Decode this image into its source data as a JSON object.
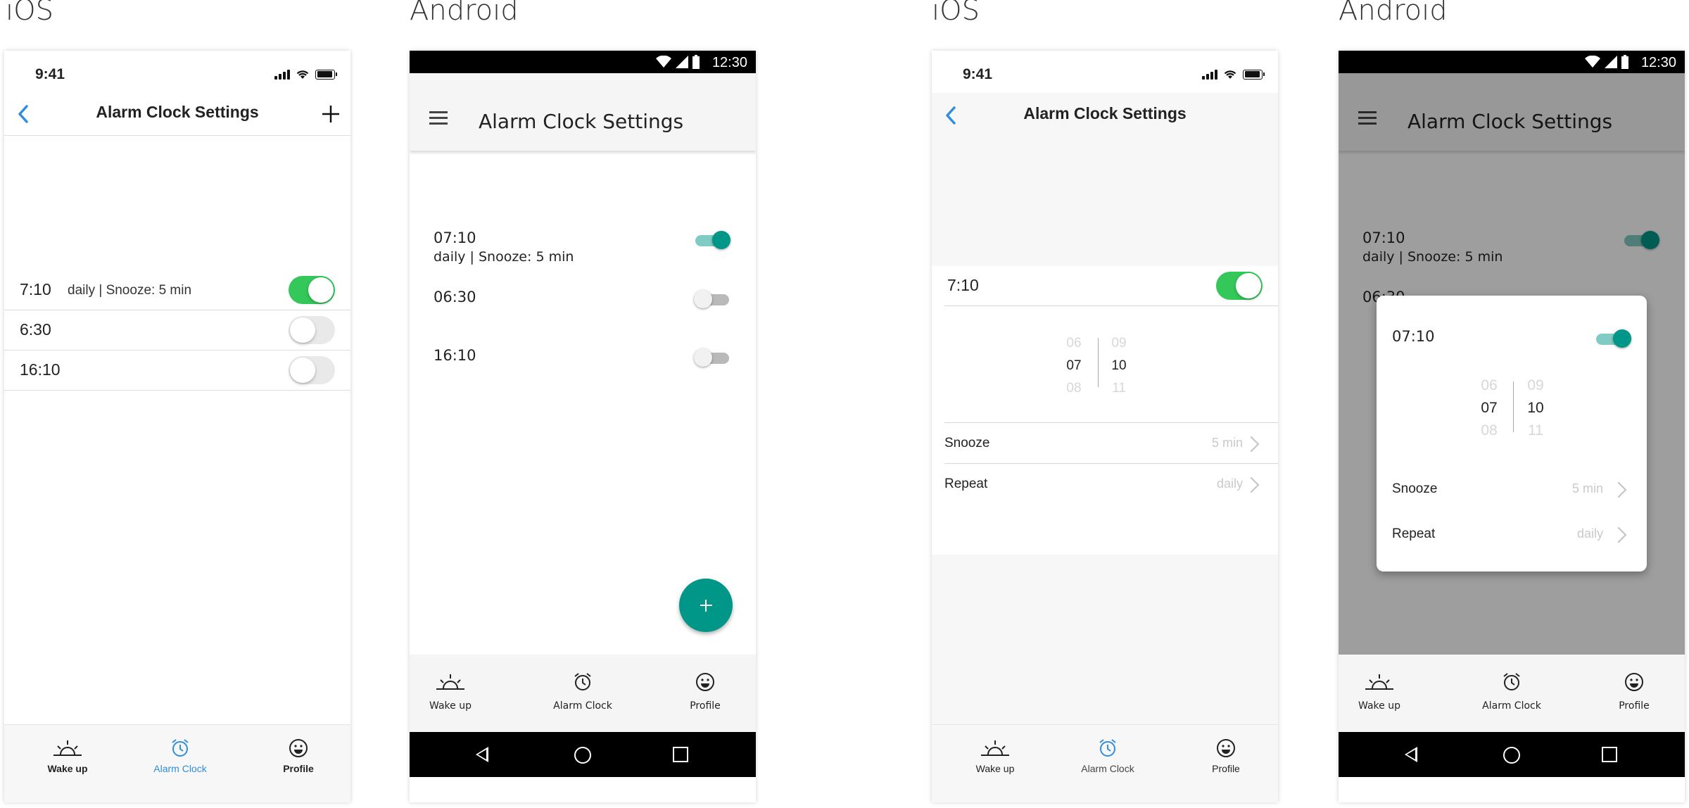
{
  "labels": [
    "iOS",
    "Android",
    "iOS",
    "Android"
  ],
  "status": {
    "ios_time": "9:41",
    "android_time": "12:30"
  },
  "app": {
    "title": "Alarm Clock Settings"
  },
  "ios_list": {
    "alarms": [
      {
        "time": "7:10",
        "detail": "daily | Snooze: 5 min",
        "on": true
      },
      {
        "time": "6:30",
        "detail": "",
        "on": false
      },
      {
        "time": "16:10",
        "detail": "",
        "on": false
      }
    ]
  },
  "android_list": {
    "alarms": [
      {
        "time": "07:10",
        "detail": "daily | Snooze: 5 min",
        "on": true
      },
      {
        "time": "06:30",
        "detail": "",
        "on": false
      },
      {
        "time": "16:10",
        "detail": "",
        "on": false
      }
    ],
    "partial_time": "06:30"
  },
  "tabs": {
    "wake_up": "Wake up",
    "alarm_clock": "Alarm Clock",
    "profile": "Profile"
  },
  "ios_detail": {
    "time": "7:10",
    "picker": {
      "hours": [
        "06",
        "07",
        "08"
      ],
      "minutes": [
        "09",
        "10",
        "11"
      ]
    },
    "snooze": {
      "label": "Snooze",
      "value": "5 min"
    },
    "repeat": {
      "label": "Repeat",
      "value": "daily"
    }
  },
  "android_dialog": {
    "time": "07:10",
    "picker": {
      "hours": [
        "06",
        "07",
        "08"
      ],
      "minutes": [
        "09",
        "10",
        "11"
      ]
    },
    "snooze": {
      "label": "Snooze",
      "value": "5 min"
    },
    "repeat": {
      "label": "Repeat",
      "value": "daily"
    }
  },
  "colors": {
    "ios_green": "#34c759",
    "ios_blue": "#2f8fde",
    "android_teal": "#009688"
  }
}
